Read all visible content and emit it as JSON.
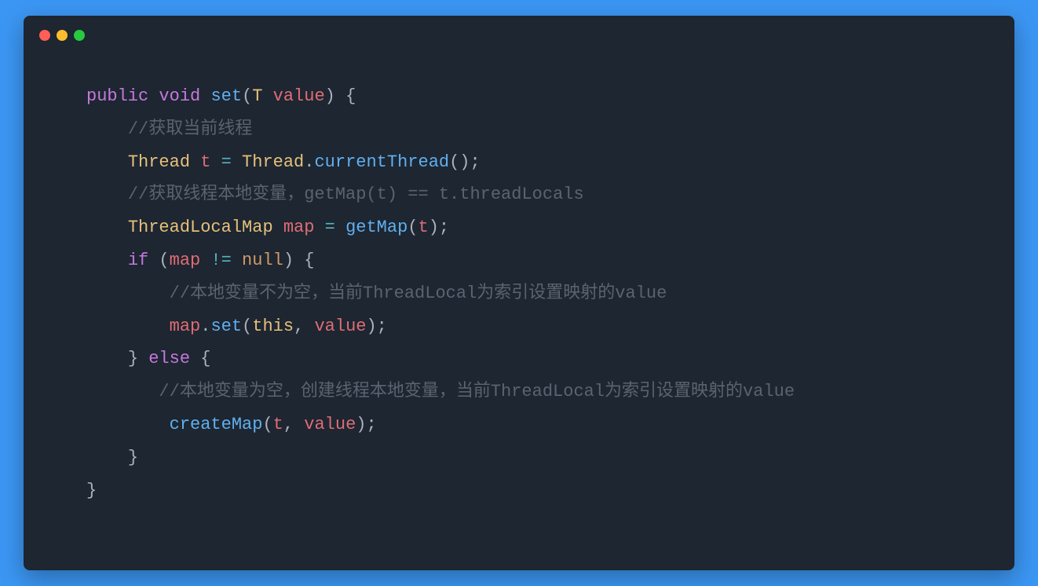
{
  "window": {
    "dots": [
      "red",
      "yellow",
      "green"
    ]
  },
  "code": {
    "l1": {
      "public": "public",
      "void": "void",
      "set": "set",
      "lpar": "(",
      "T": "T",
      "sp": " ",
      "value": "value",
      "rparb": ") {"
    },
    "l2": {
      "comment": "//获取当前线程"
    },
    "l3": {
      "Thread1": "Thread",
      "sp1": " ",
      "t": "t",
      "eq": " = ",
      "Thread2": "Thread",
      "dot": ".",
      "currentThread": "currentThread",
      "paren": "();"
    },
    "l4": {
      "comment": "//获取线程本地变量，getMap(t) == t.threadLocals"
    },
    "l5": {
      "TLM": "ThreadLocalMap",
      "sp1": " ",
      "map": "map",
      "eq": " = ",
      "getMap": "getMap",
      "lpar": "(",
      "t": "t",
      "rpar": ");"
    },
    "l6": {
      "if": "if",
      "sp": " ",
      "lpar": "(",
      "map": "map",
      "neq": " != ",
      "null": "null",
      "rparb": ") {"
    },
    "l7": {
      "comment": "//本地变量不为空，当前ThreadLocal为索引设置映射的value"
    },
    "l8": {
      "map": "map",
      "dot": ".",
      "set": "set",
      "lpar": "(",
      "this": "this",
      "comma": ", ",
      "value": "value",
      "rpar": ");"
    },
    "l9": {
      "closeb": "} ",
      "else": "else",
      "openb": " {"
    },
    "l10": {
      "comment": "//本地变量为空，创建线程本地变量，当前ThreadLocal为索引设置映射的value"
    },
    "l11": {
      "createMap": "createMap",
      "lpar": "(",
      "t": "t",
      "comma": ", ",
      "value": "value",
      "rpar": ");"
    },
    "l12": {
      "close": "}"
    },
    "l13": {
      "close": "}"
    }
  }
}
